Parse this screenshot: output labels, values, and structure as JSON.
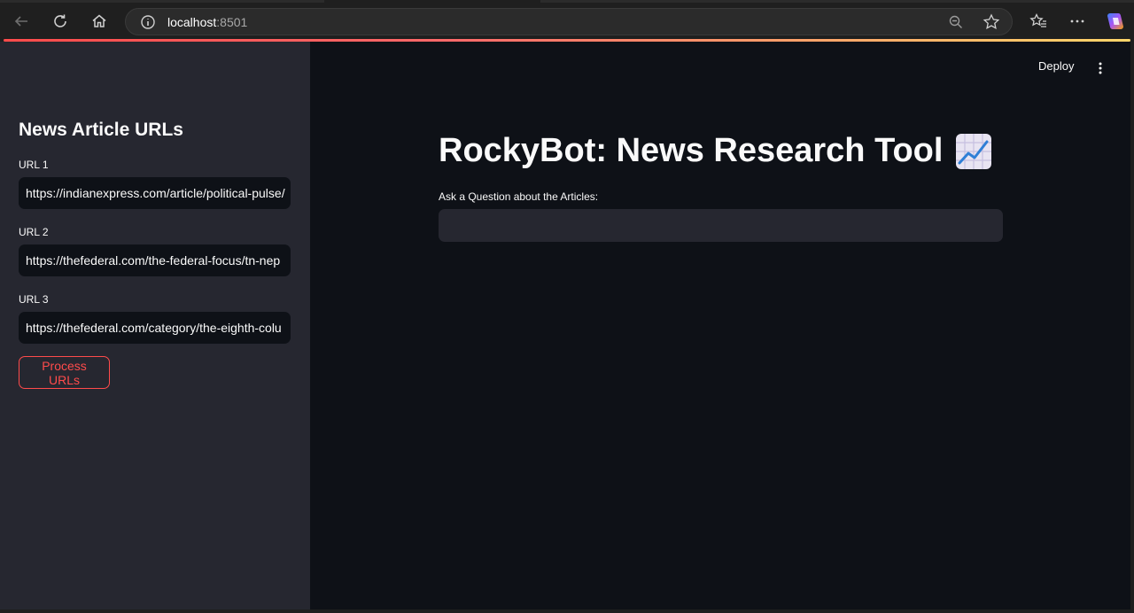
{
  "browser": {
    "url_host": "localhost",
    "url_port": ":8501"
  },
  "sidebar": {
    "title": "News Article URLs",
    "fields": [
      {
        "label": "URL 1",
        "value": "https://indianexpress.com/article/political-pulse/"
      },
      {
        "label": "URL 2",
        "value": "https://thefederal.com/the-federal-focus/tn-nep"
      },
      {
        "label": "URL 3",
        "value": "https://thefederal.com/category/the-eighth-colu"
      }
    ],
    "process_label": "Process URLs"
  },
  "header": {
    "deploy_label": "Deploy"
  },
  "main": {
    "title": "RockyBot: News Research Tool",
    "question_label": "Ask a Question about the Articles:",
    "question_value": ""
  },
  "colors": {
    "accent": "#ff4b4b",
    "sidebar_bg": "#262730",
    "main_bg": "#0e1117"
  },
  "icons": [
    "back-arrow-icon",
    "refresh-icon",
    "home-icon",
    "info-icon",
    "zoom-out-icon",
    "star-icon",
    "favorites-icon",
    "more-icon",
    "copilot-icon",
    "kebab-menu-icon",
    "chart-increasing-emoji"
  ]
}
